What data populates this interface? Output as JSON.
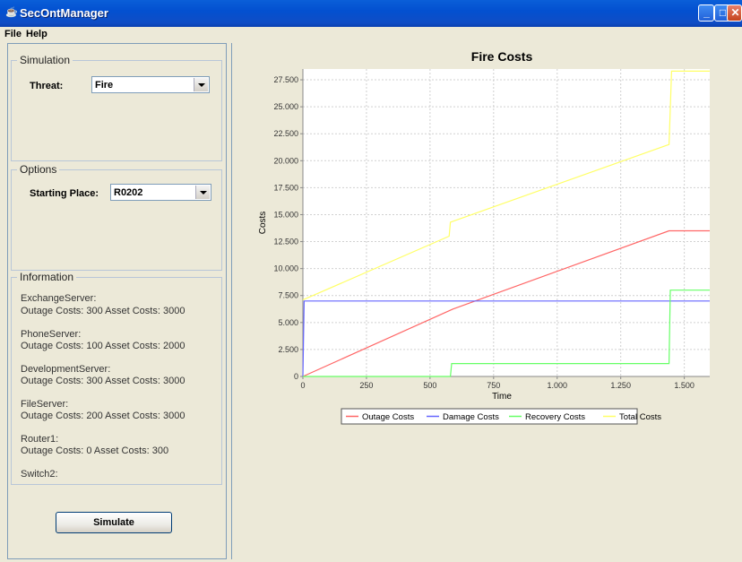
{
  "window": {
    "title": "SecOntManager",
    "icon": "app-icon",
    "controls": [
      "minimize-icon",
      "maximize-icon",
      "close-icon"
    ]
  },
  "menu": [
    "File",
    "Help"
  ],
  "simulation": {
    "group_title": "Simulation",
    "threat_label": "Threat:",
    "threat_value": "Fire"
  },
  "options": {
    "group_title": "Options",
    "starting_label": "Starting Place:",
    "starting_value": "R0202"
  },
  "information": {
    "group_title": "Information",
    "entries": [
      {
        "name": "ExchangeServer:",
        "detail": "Outage Costs: 300 Asset Costs: 3000"
      },
      {
        "name": "PhoneServer:",
        "detail": "Outage Costs: 100 Asset Costs: 2000"
      },
      {
        "name": "DevelopmentServer:",
        "detail": "Outage Costs: 300 Asset Costs: 3000"
      },
      {
        "name": "FileServer:",
        "detail": "Outage Costs: 200 Asset Costs: 3000"
      },
      {
        "name": "Router1:",
        "detail": "Outage Costs: 0 Asset Costs: 300"
      },
      {
        "name": "Switch2:",
        "detail": ""
      }
    ]
  },
  "simulate_label": "Simulate",
  "chart_data": {
    "type": "line",
    "title": "Fire Costs",
    "xlabel": "Time",
    "ylabel": "Costs",
    "xlim": [
      0,
      1600
    ],
    "ylim": [
      0,
      28500
    ],
    "xticks": [
      0,
      250,
      500,
      750,
      1000,
      1250,
      1500
    ],
    "xtick_labels": [
      "0",
      "250",
      "500",
      "750",
      "1.000",
      "1.250",
      "1.500"
    ],
    "yticks": [
      0,
      2500,
      5000,
      7500,
      10000,
      12500,
      15000,
      17500,
      20000,
      22500,
      25000,
      27500
    ],
    "ytick_labels": [
      "0",
      "2.500",
      "5.000",
      "7.500",
      "10.000",
      "12.500",
      "15.000",
      "17.500",
      "20.000",
      "22.500",
      "25.000",
      "27.500"
    ],
    "grid": true,
    "legend_position": "bottom",
    "series": [
      {
        "name": "Outage Costs",
        "color": "#ff6666",
        "points": [
          [
            0,
            0
          ],
          [
            590,
            6250
          ],
          [
            1440,
            13500
          ],
          [
            1600,
            13500
          ]
        ]
      },
      {
        "name": "Damage Costs",
        "color": "#6666ff",
        "points": [
          [
            0,
            0
          ],
          [
            5,
            7000
          ],
          [
            1600,
            7000
          ]
        ]
      },
      {
        "name": "Recovery Costs",
        "color": "#66ff66",
        "points": [
          [
            0,
            0
          ],
          [
            580,
            0
          ],
          [
            585,
            1200
          ],
          [
            1440,
            1200
          ],
          [
            1445,
            8000
          ],
          [
            1600,
            8000
          ]
        ]
      },
      {
        "name": "Total Costs",
        "color": "#ffff66",
        "points": [
          [
            0,
            7100
          ],
          [
            575,
            13000
          ],
          [
            580,
            14300
          ],
          [
            1440,
            21500
          ],
          [
            1450,
            28300
          ],
          [
            1600,
            28300
          ]
        ]
      }
    ]
  }
}
